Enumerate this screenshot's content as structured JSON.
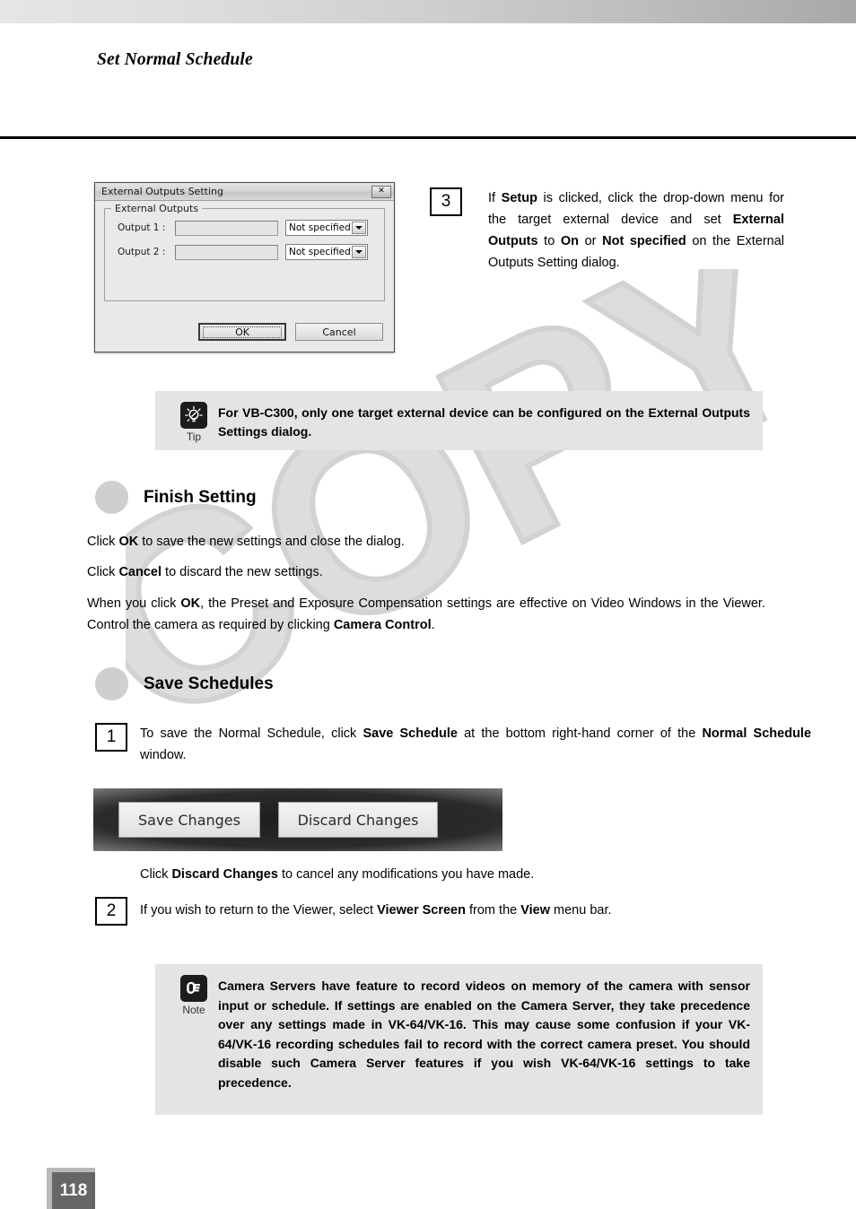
{
  "header": {
    "title": "Set Normal Schedule"
  },
  "dialog": {
    "title": "External Outputs Setting",
    "close_icon": "close-icon",
    "fieldset_legend": "External Outputs",
    "rows": [
      {
        "label": "Output 1 :",
        "value": "",
        "select_value": "Not specified"
      },
      {
        "label": "Output 2 :",
        "value": "",
        "select_value": "Not specified"
      }
    ],
    "ok_label": "OK",
    "cancel_label": "Cancel"
  },
  "step3": {
    "number": "3",
    "text_parts": [
      {
        "t": "If ",
        "b": false
      },
      {
        "t": "Setup",
        "b": true
      },
      {
        "t": " is clicked, click the drop-down menu for the target external device and set ",
        "b": false
      },
      {
        "t": "External Outputs",
        "b": true
      },
      {
        "t": " to ",
        "b": false
      },
      {
        "t": "On",
        "b": true
      },
      {
        "t": " or ",
        "b": false
      },
      {
        "t": "Not specified",
        "b": true
      },
      {
        "t": " on the External Outputs Setting dialog.",
        "b": false
      }
    ]
  },
  "tip": {
    "icon": "lightbulb-icon",
    "label": "Tip",
    "text": "For VB-C300, only one target external device can be configured on the External Outputs Settings dialog."
  },
  "sections": {
    "finish_setting": {
      "title": "Finish Setting",
      "paragraphs": [
        [
          {
            "t": "Click ",
            "b": false
          },
          {
            "t": "OK",
            "b": true
          },
          {
            "t": " to save the new settings and close the dialog.",
            "b": false
          }
        ],
        [
          {
            "t": "Click ",
            "b": false
          },
          {
            "t": "Cancel",
            "b": true
          },
          {
            "t": " to discard the new settings.",
            "b": false
          }
        ],
        [
          {
            "t": "When you click ",
            "b": false
          },
          {
            "t": "OK",
            "b": true
          },
          {
            "t": ", the Preset and Exposure Compensation settings are effective on Video Windows in the Viewer. Control the camera as required by clicking ",
            "b": false
          },
          {
            "t": "Camera Control",
            "b": true
          },
          {
            "t": ".",
            "b": false
          }
        ]
      ]
    },
    "save_schedules": {
      "title": "Save Schedules"
    }
  },
  "step1": {
    "number": "1",
    "text_parts": [
      {
        "t": "To save the Normal Schedule, click ",
        "b": false
      },
      {
        "t": "Save Schedule",
        "b": true
      },
      {
        "t": " at the bottom right-hand corner of the ",
        "b": false
      },
      {
        "t": "Normal Schedule",
        "b": true
      },
      {
        "t": " window.",
        "b": false
      }
    ]
  },
  "screenshot_buttons": {
    "save_changes": "Save Changes",
    "discard_changes": "Discard Changes"
  },
  "discard_paragraph": [
    {
      "t": "Click ",
      "b": false
    },
    {
      "t": "Discard Changes",
      "b": true
    },
    {
      "t": " to cancel any modifications you have made.",
      "b": false
    }
  ],
  "step2": {
    "number": "2",
    "text_parts": [
      {
        "t": "If you wish to return to the Viewer, select ",
        "b": false
      },
      {
        "t": "Viewer Screen",
        "b": true
      },
      {
        "t": " from the ",
        "b": false
      },
      {
        "t": "View",
        "b": true
      },
      {
        "t": " menu bar.",
        "b": false
      }
    ]
  },
  "note": {
    "icon": "pointing-hand-icon",
    "label": "Note",
    "text": "Camera Servers have feature to record videos on memory of the camera with sensor input or schedule. If settings are enabled on the Camera Server, they take precedence over any settings made in VK-64/VK-16. This may cause some confusion if your VK-64/VK-16 recording schedules fail to record with the correct camera preset. You should disable such Camera Server features if you wish VK-64/VK-16 settings to take precedence."
  },
  "page_number": "118",
  "watermark": {
    "text": "COPY",
    "color": "#dcdcdc"
  },
  "colors": {
    "info_box_bg": "#e4e4e4",
    "bullet": "#cfcfcf",
    "page_num_bg": "#666666"
  }
}
